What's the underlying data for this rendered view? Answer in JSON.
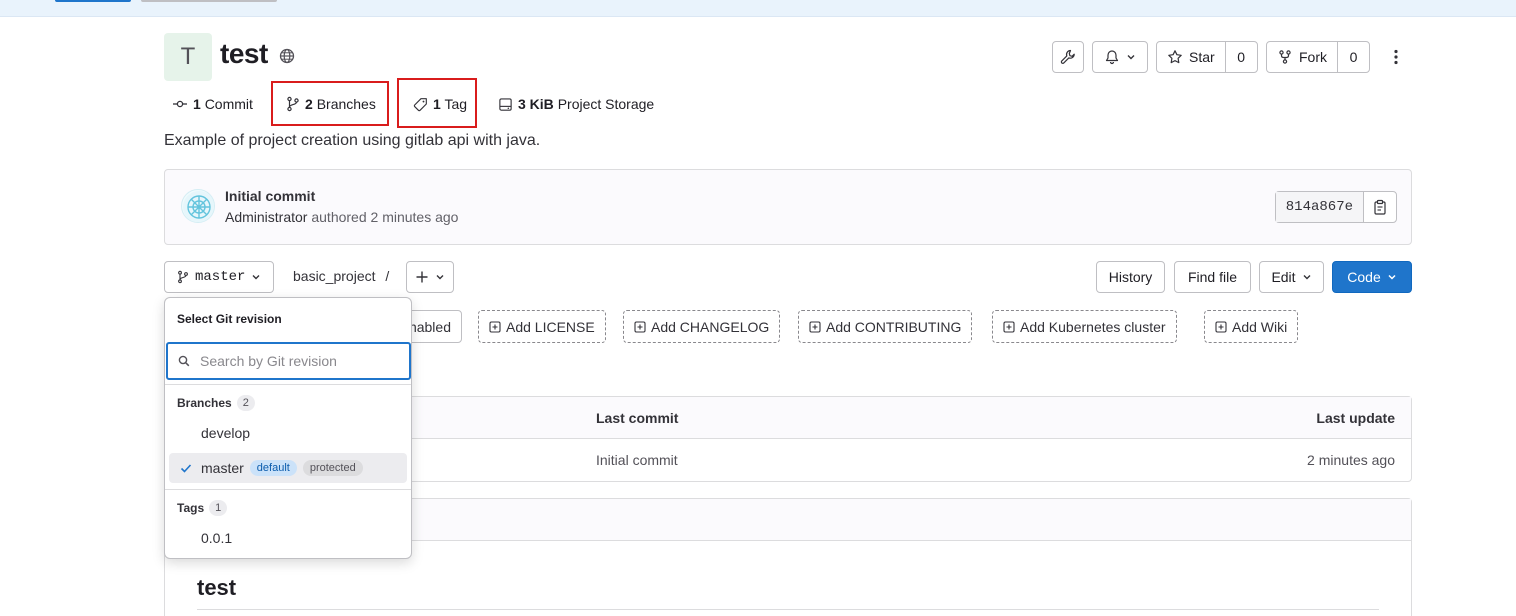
{
  "project": {
    "avatar_letter": "T",
    "title": "test",
    "description": "Example of project creation using gitlab api with java."
  },
  "stats": {
    "commits_count": "1",
    "commits_label": "Commit",
    "branches_count": "2",
    "branches_label": "Branches",
    "tags_count": "1",
    "tags_label": "Tag",
    "storage_size": "3 KiB",
    "storage_label": "Project Storage"
  },
  "actions": {
    "star_label": "Star",
    "star_count": "0",
    "fork_label": "Fork",
    "fork_count": "0"
  },
  "last_commit": {
    "title": "Initial commit",
    "author": "Administrator",
    "meta": "authored 2 minutes ago",
    "sha": "814a867e"
  },
  "repo_nav": {
    "branch": "master",
    "path": "basic_project",
    "separator": "/",
    "history_label": "History",
    "find_file_label": "Find file",
    "edit_label": "Edit",
    "code_label": "Code"
  },
  "shortcuts": {
    "partial_label": "nabled",
    "items": [
      "Add LICENSE",
      "Add CHANGELOG",
      "Add CONTRIBUTING",
      "Add Kubernetes cluster",
      "Add Wiki"
    ]
  },
  "file_table": {
    "col_last_commit": "Last commit",
    "col_last_update": "Last update",
    "row": {
      "last_commit": "Initial commit",
      "last_update": "2 minutes ago"
    }
  },
  "readme": {
    "heading": "test"
  },
  "revision_dropdown": {
    "title": "Select Git revision",
    "search_placeholder": "Search by Git revision",
    "branches_label": "Branches",
    "branches_count": "2",
    "branches": [
      {
        "name": "develop"
      },
      {
        "name": "master",
        "badge_default": "default",
        "badge_protected": "protected"
      }
    ],
    "tags_label": "Tags",
    "tags_count": "1",
    "tags": [
      {
        "name": "0.0.1"
      }
    ]
  },
  "colors": {
    "primary": "#1f75cb",
    "highlight_border": "#d91c1c",
    "badge_info_bg": "#cbe2f9"
  }
}
